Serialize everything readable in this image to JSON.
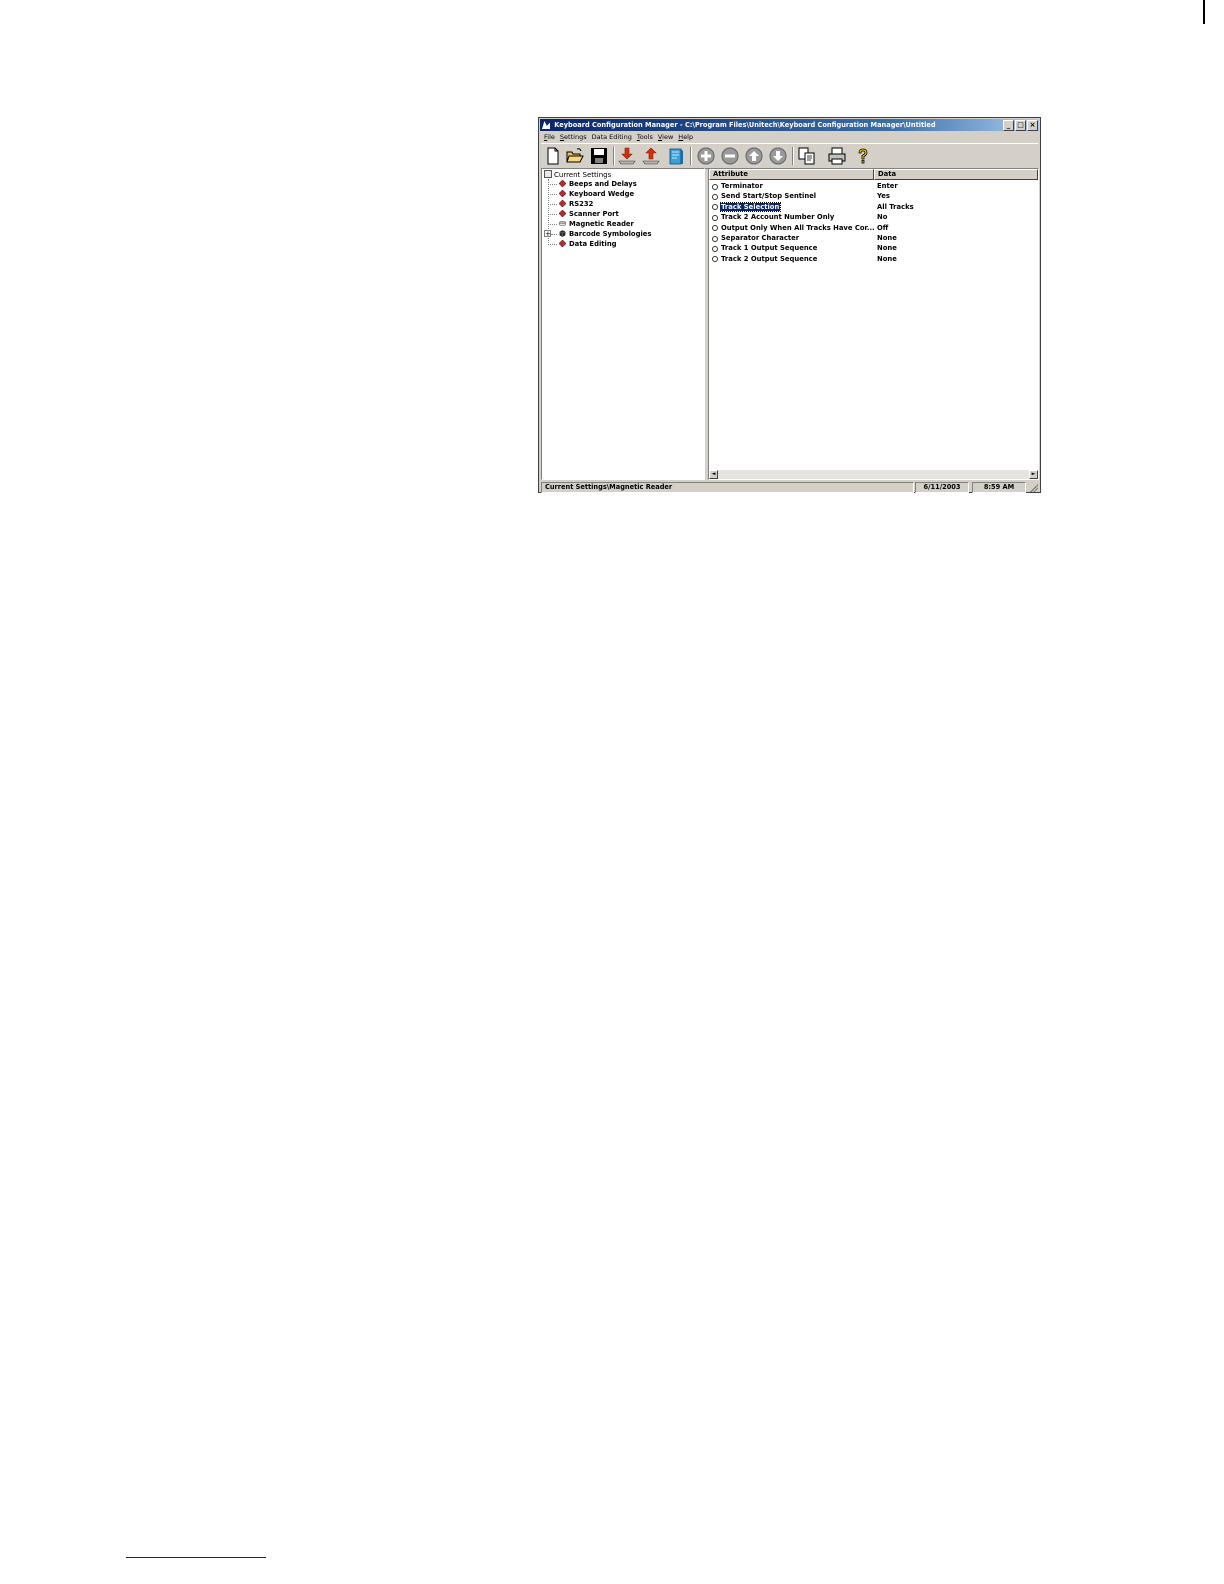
{
  "window": {
    "title": "Keyboard Configuration Manager - C:\\Program Files\\Unitech\\Keyboard Configuration Manager\\Untitled",
    "controls": {
      "minimize": "_",
      "maximize": "□",
      "close": "×"
    }
  },
  "menu": [
    {
      "label": "File",
      "accel": "F",
      "rest": "ile"
    },
    {
      "label": "Settings",
      "accel": "S",
      "rest": "ettings"
    },
    {
      "label": "Data Editing",
      "accel": "",
      "rest": "Data Editing"
    },
    {
      "label": "Tools",
      "accel": "T",
      "rest": "ools"
    },
    {
      "label": "View",
      "accel": "V",
      "rest": "iew"
    },
    {
      "label": "Help",
      "accel": "H",
      "rest": "elp"
    }
  ],
  "toolbar": [
    {
      "name": "new-file-icon"
    },
    {
      "name": "open-folder-icon"
    },
    {
      "name": "save-disk-icon"
    },
    {
      "name": "download-to-device-icon"
    },
    {
      "name": "upload-from-device-icon"
    },
    {
      "name": "barcode-book-icon"
    },
    {
      "name": "add-circle-icon"
    },
    {
      "name": "remove-circle-icon"
    },
    {
      "name": "move-up-circle-icon"
    },
    {
      "name": "move-down-circle-icon"
    },
    {
      "name": "copy-pages-icon"
    },
    {
      "name": "printer-icon"
    },
    {
      "name": "help-question-icon"
    }
  ],
  "tree": {
    "root": "Current Settings",
    "items": [
      {
        "label": "Beeps and Delays",
        "icon": "settings-gem-icon"
      },
      {
        "label": "Keyboard Wedge",
        "icon": "settings-gem-icon"
      },
      {
        "label": "RS232",
        "icon": "settings-gem-icon"
      },
      {
        "label": "Scanner Port",
        "icon": "settings-gem-icon"
      },
      {
        "label": "Magnetic Reader",
        "icon": "magnetic-card-icon"
      },
      {
        "label": "Barcode Symbologies",
        "icon": "barcode-cube-icon",
        "expandable": true,
        "expander": "+"
      },
      {
        "label": "Data Editing",
        "icon": "settings-gem-icon"
      }
    ]
  },
  "list": {
    "columns": {
      "attribute": "Attribute",
      "data": "Data"
    },
    "rows": [
      {
        "attribute": "Terminator",
        "data": "Enter"
      },
      {
        "attribute": "Send Start/Stop Sentinel",
        "data": "Yes"
      },
      {
        "attribute": "Track Selection",
        "data": "All Tracks",
        "selected": true
      },
      {
        "attribute": "Track 2 Account Number Only",
        "data": "No"
      },
      {
        "attribute": "Output Only When All Tracks Have Cor...",
        "data": "Off"
      },
      {
        "attribute": "Separator Character",
        "data": "None"
      },
      {
        "attribute": "Track 1 Output Sequence",
        "data": "None"
      },
      {
        "attribute": "Track 2 Output Sequence",
        "data": "None"
      }
    ],
    "scroll": {
      "left": "◄",
      "right": "►"
    }
  },
  "status": {
    "path": "Current Settings\\Magnetic Reader",
    "date": "6/11/2003",
    "time": "8:59 AM"
  },
  "colors": {
    "titlebar": "#0a246a",
    "face": "#d4d0c8",
    "selection": "#0a246a",
    "gem": "#b03030"
  }
}
